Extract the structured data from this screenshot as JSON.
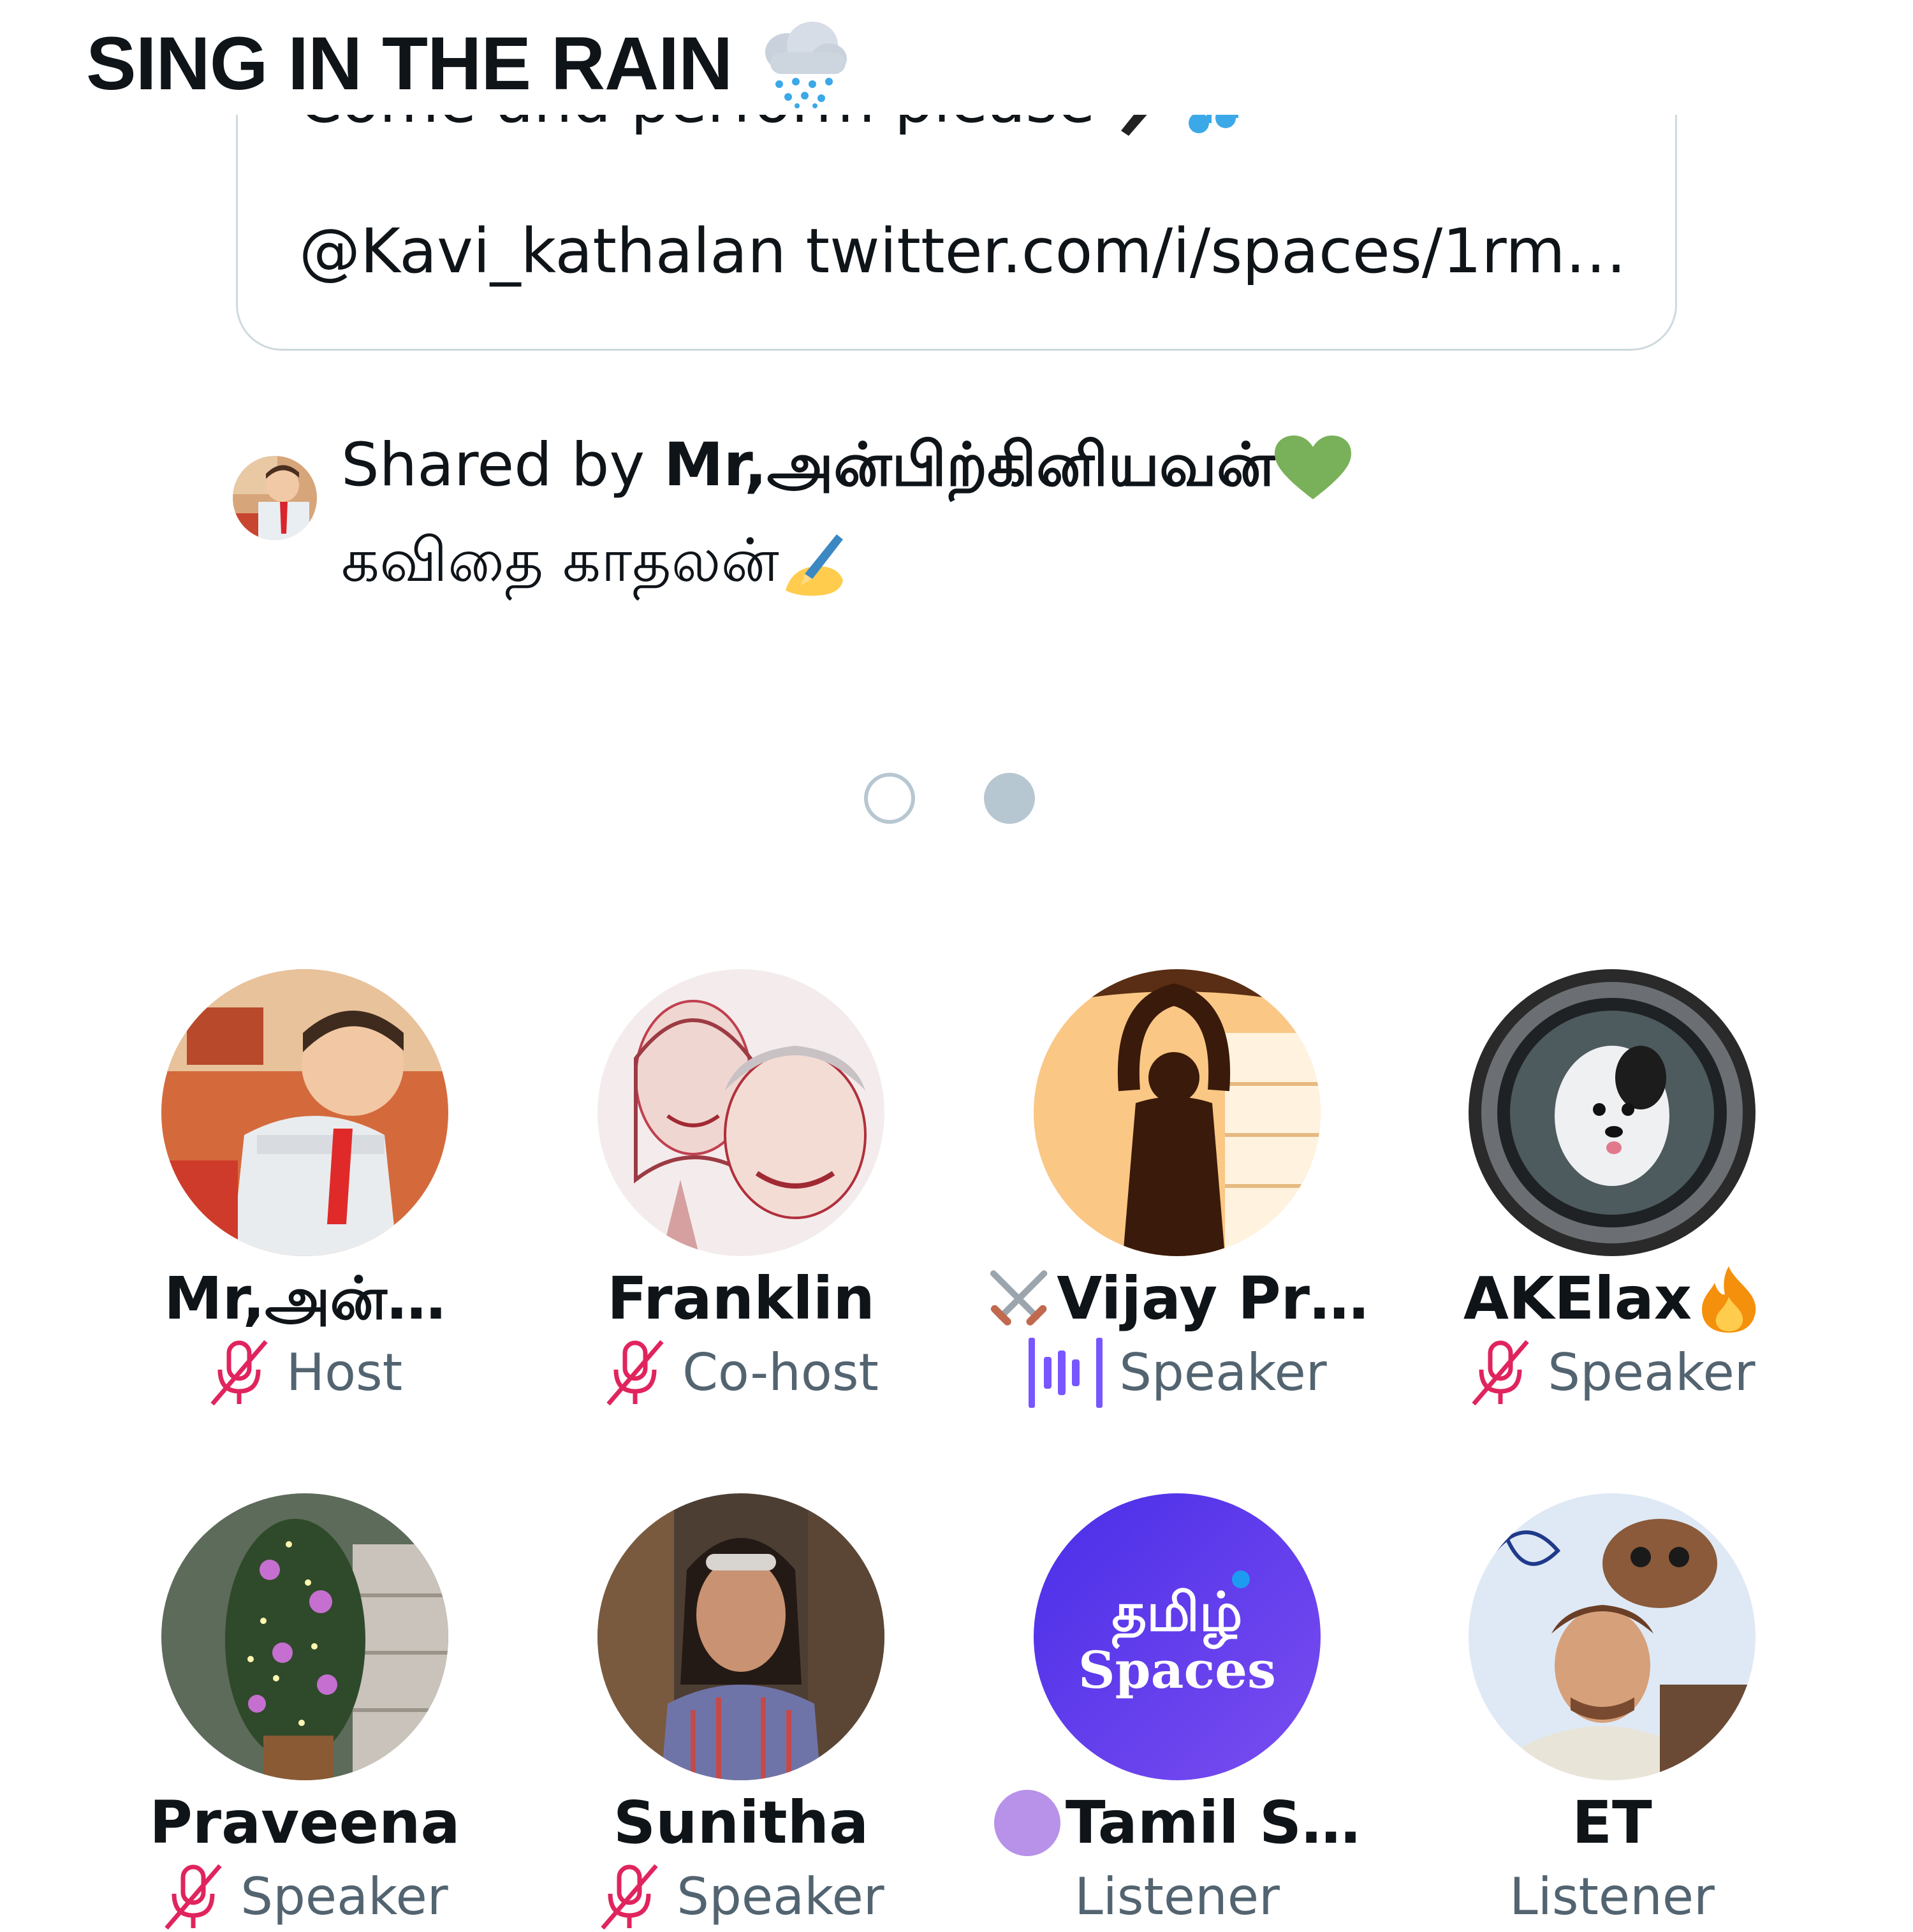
{
  "space": {
    "title": "SING IN THE RAIN",
    "title_emoji": "cloud-with-rain-icon"
  },
  "tweet_card": {
    "line1": "Come and perform please",
    "line2": "@Kavi_kathalan twitter.com/i/spaces/1rm…"
  },
  "shared": {
    "prefix": "Shared by ",
    "name": "Mr,அன்பிற்கினியவன்",
    "line2": "கவிதை காதலன்",
    "heart_emoji": "green-heart-icon",
    "writing_emoji": "writing-hand-icon"
  },
  "pager": {
    "pages": 2,
    "current": 1
  },
  "participants": [
    {
      "name": "Mr,அன்…",
      "role": "Host",
      "mic": "muted"
    },
    {
      "name": "Franklin",
      "role": "Co-host",
      "mic": "muted"
    },
    {
      "name": "Vijay Pr…",
      "role": "Speaker",
      "mic": "speaking",
      "name_prefix_icon": "crossed-swords-icon"
    },
    {
      "name": "AKElax",
      "role": "Speaker",
      "mic": "muted",
      "name_suffix_icon": "fire-icon"
    },
    {
      "name": "Praveena",
      "role": "Speaker",
      "mic": "muted"
    },
    {
      "name": "Sunitha",
      "role": "Speaker",
      "mic": "muted"
    },
    {
      "name": "Tamil S…",
      "role": "Listener",
      "mic": "none",
      "avatar_text": [
        "தமிழ்",
        "Spaces"
      ]
    },
    {
      "name": "ET",
      "role": "Listener",
      "mic": "none"
    }
  ],
  "colors": {
    "muted_mic": "#e0245e",
    "speaking": "#7856ff",
    "role_text": "#536471",
    "pager": "#b7c7d1",
    "card_border": "#cfd9de",
    "tamil_spaces_avatar": "#5b3ae8"
  }
}
